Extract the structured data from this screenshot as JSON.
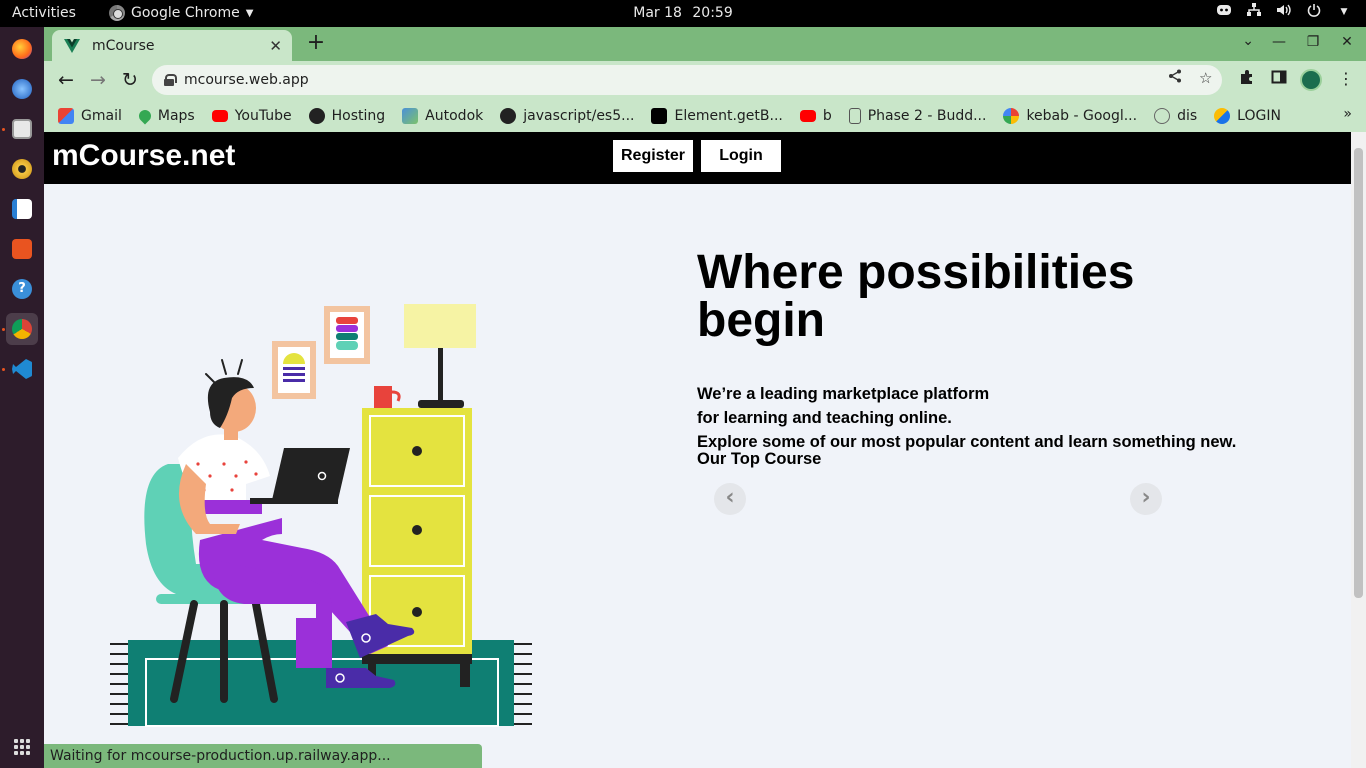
{
  "system": {
    "activities": "Activities",
    "app_name": "Google Chrome",
    "clock_date": "Mar 18",
    "clock_time": "20:59"
  },
  "browser": {
    "tab_title": "mCourse",
    "url": "mcourse.web.app",
    "bookmarks": [
      {
        "label": "Gmail",
        "icon": "gmail-icon",
        "color": "#ea4335"
      },
      {
        "label": "Maps",
        "icon": "maps-icon",
        "color": "#34a853"
      },
      {
        "label": "YouTube",
        "icon": "youtube-icon",
        "color": "#ff0000"
      },
      {
        "label": "Hosting",
        "icon": "globe-icon",
        "color": "#222222"
      },
      {
        "label": "Autodok",
        "icon": "autodok-icon",
        "color": "#4a90d9"
      },
      {
        "label": "javascript/es5...",
        "icon": "github-icon",
        "color": "#222222"
      },
      {
        "label": "Element.getB...",
        "icon": "mdn-icon",
        "color": "#000000"
      },
      {
        "label": "b",
        "icon": "youtube-icon",
        "color": "#ff0000"
      },
      {
        "label": "Phase 2 - Budd...",
        "icon": "clipboard-icon",
        "color": "#555555"
      },
      {
        "label": "kebab - Googl...",
        "icon": "google-icon",
        "color": "#4285f4"
      },
      {
        "label": "dis",
        "icon": "share-icon",
        "color": "#666666"
      },
      {
        "label": "LOGIN",
        "icon": "login-icon",
        "color": "#1a73e8"
      }
    ],
    "status_text": "Waiting for mcourse-production.up.railway.app..."
  },
  "site": {
    "brand": "mCourse.net",
    "register_label": "Register",
    "login_label": "Login",
    "hero_title": "Where possibilities begin",
    "hero_sub_1": "We’re a leading marketplace platform",
    "hero_sub_2": "for learning and teaching online.",
    "hero_sub_3": "Explore some of our most popular content and learn something new.",
    "top_course_label": "Our Top Course",
    "prev_arrow": "‹",
    "next_arrow": "›"
  },
  "colors": {
    "tab_strip": "#7bb87c",
    "toolbar": "#c9e6c9",
    "page_bg": "#f0f3f9",
    "nav_bg": "#000000",
    "teal": "#5fd1b6",
    "purple": "#9b30d9",
    "yellow": "#e4e33f",
    "rug": "#0f7f73"
  }
}
